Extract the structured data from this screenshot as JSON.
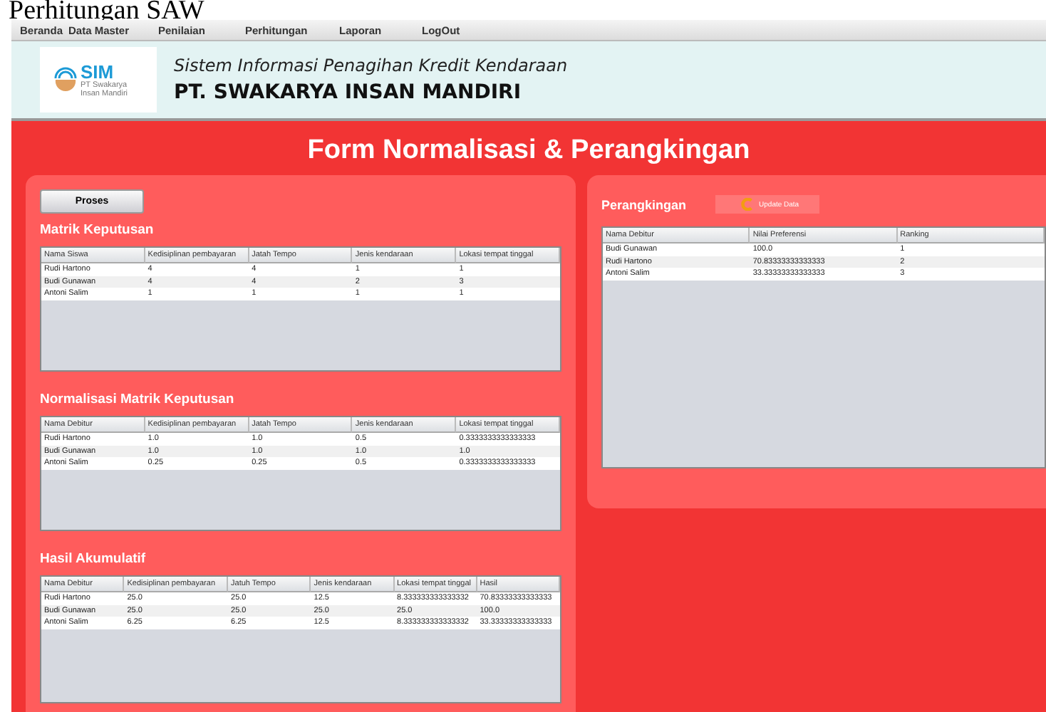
{
  "page_title": "Perhitungan SAW",
  "menu": [
    "Beranda",
    "Data Master",
    "Penilaian",
    "Perhitungan",
    "Laporan",
    "LogOut"
  ],
  "header": {
    "logo_text": "SIM",
    "logo_caption": "PT Swakarya Insan Mandiri",
    "subtitle": "Sistem Informasi Penagihan Kredit Kendaraan",
    "company": "PT. SWAKARYA INSAN MANDIRI"
  },
  "form_title": "Form Normalisasi & Perangkingan",
  "process_button": "Proses",
  "sections": [
    {
      "title": "Matrik Keputusan",
      "columns": [
        "Nama Siswa",
        "Kedisiplinan pembayaran",
        "Jatah Tempo",
        "Jenis kendaraan",
        "Lokasi tempat tinggal"
      ],
      "rows": [
        [
          "Rudi Hartono",
          "4",
          "4",
          "1",
          "1"
        ],
        [
          "Budi Gunawan",
          "4",
          "4",
          "2",
          "3"
        ],
        [
          "Antoni Salim",
          "1",
          "1",
          "1",
          "1"
        ]
      ]
    },
    {
      "title": "Normalisasi Matrik Keputusan",
      "columns": [
        "Nama Debitur",
        "Kedisiplinan pembayaran",
        "Jatah Tempo",
        "Jenis kendaraan",
        "Lokasi tempat tinggal"
      ],
      "rows": [
        [
          "Rudi Hartono",
          "1.0",
          "1.0",
          "0.5",
          "0.3333333333333333"
        ],
        [
          "Budi Gunawan",
          "1.0",
          "1.0",
          "1.0",
          "1.0"
        ],
        [
          "Antoni Salim",
          "0.25",
          "0.25",
          "0.5",
          "0.3333333333333333"
        ]
      ]
    },
    {
      "title": "Hasil Akumulatif",
      "columns": [
        "Nama Debitur",
        "Kedisiplinan pembayaran",
        "Jatuh Tempo",
        "Jenis kendaraan",
        "Lokasi tempat tinggal",
        "Hasil"
      ],
      "rows": [
        [
          "Rudi Hartono",
          "25.0",
          "25.0",
          "12.5",
          "8.333333333333332",
          "70.83333333333333"
        ],
        [
          "Budi Gunawan",
          "25.0",
          "25.0",
          "25.0",
          "25.0",
          "100.0"
        ],
        [
          "Antoni Salim",
          "6.25",
          "6.25",
          "12.5",
          "8.333333333333332",
          "33.33333333333333"
        ]
      ]
    }
  ],
  "ranking": {
    "title": "Perangkingan",
    "update_button": "Update Data",
    "columns": [
      "Nama Debitur",
      "Nilai Preferensi",
      "Ranking"
    ],
    "rows": [
      [
        "Budi Gunawan",
        "100.0",
        "1"
      ],
      [
        "Rudi Hartono",
        "70.83333333333333",
        "2"
      ],
      [
        "Antoni Salim",
        "33.33333333333333",
        "3"
      ]
    ]
  }
}
